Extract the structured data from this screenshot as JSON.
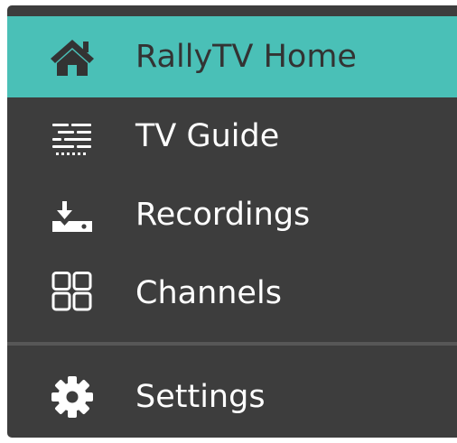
{
  "menu": {
    "items": [
      {
        "label": "RallyTV Home",
        "icon": "home-icon",
        "active": true
      },
      {
        "label": "TV Guide",
        "icon": "guide-list-icon",
        "active": false
      },
      {
        "label": "Recordings",
        "icon": "recording-download-icon",
        "active": false
      },
      {
        "label": "Channels",
        "icon": "grid-icon",
        "active": false
      }
    ],
    "settings": {
      "label": "Settings",
      "icon": "gear-icon"
    }
  },
  "colors": {
    "active_background": "#4ac0b7",
    "menu_background": "#3d3d3d",
    "divider": "#575757",
    "text": "#ffffff",
    "active_text": "#333333"
  }
}
